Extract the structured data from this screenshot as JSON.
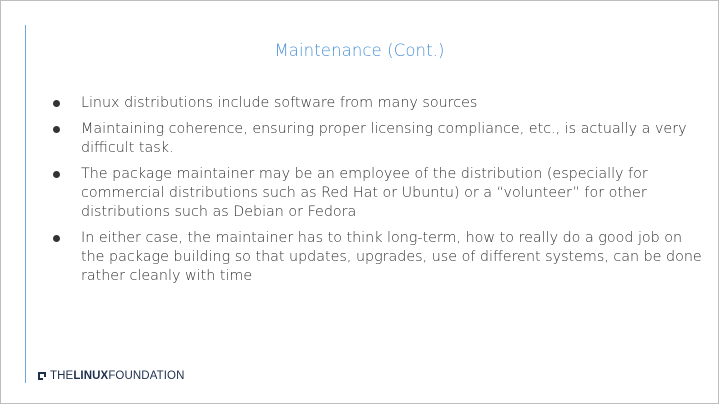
{
  "slide": {
    "title": "Maintenance (Cont.)",
    "bullets": [
      "Linux distributions include software from many sources",
      "Maintaining coherence, ensuring proper licensing compliance, etc., is actually a very difficult task.",
      "The package maintainer may be an employee of the distribution (especially for commercial distributions such as Red Hat or Ubuntu) or a “volunteer” for other distributions such as Debian or Fedora",
      "In either case, the maintainer has to think long-term, how to really do a good job on the package building so that updates, upgrades, use of different systems, can be done rather cleanly with time"
    ]
  },
  "footer": {
    "logo_the": "THE",
    "logo_linux": "LINUX",
    "logo_foundation": "FOUNDATION"
  },
  "colors": {
    "title": "#4a90d9",
    "accent_line": "#6fa8dc",
    "body_text": "#333333",
    "logo": "#1f2f4f"
  }
}
